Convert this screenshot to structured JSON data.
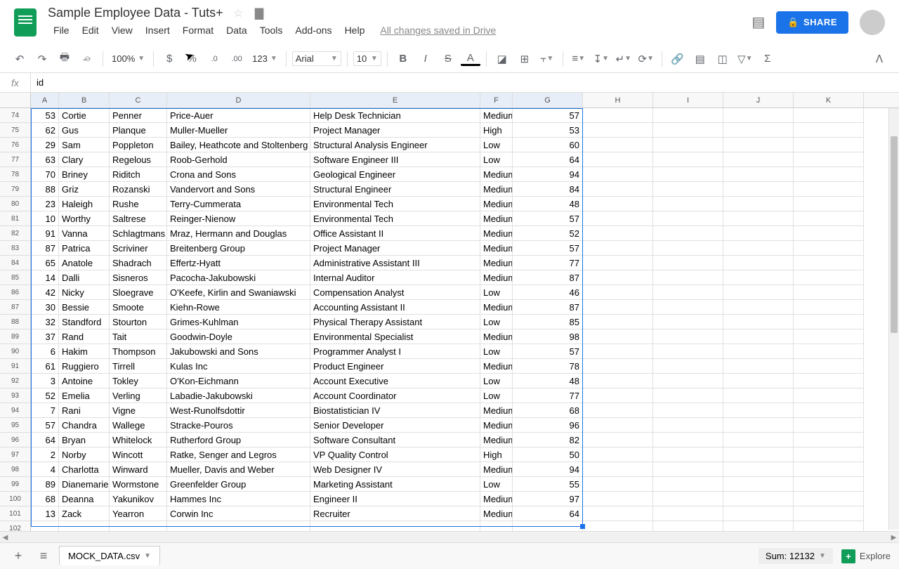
{
  "doc": {
    "title": "Sample Employee Data - Tuts+"
  },
  "menu": {
    "file": "File",
    "edit": "Edit",
    "view": "View",
    "insert": "Insert",
    "format": "Format",
    "data": "Data",
    "tools": "Tools",
    "addons": "Add-ons",
    "help": "Help",
    "saved": "All changes saved in Drive"
  },
  "share": {
    "label": "SHARE"
  },
  "toolbar": {
    "zoom": "100%",
    "format123": "123",
    "font": "Arial",
    "size": "10"
  },
  "formula": {
    "value": "id"
  },
  "columns": [
    "A",
    "B",
    "C",
    "D",
    "E",
    "F",
    "G",
    "H",
    "I",
    "J",
    "K"
  ],
  "rows": [
    {
      "n": 74,
      "a": "53",
      "b": "Cortie",
      "c": "Penner",
      "d": "Price-Auer",
      "e": "Help Desk Technician",
      "f": "Medium",
      "g": "57"
    },
    {
      "n": 75,
      "a": "62",
      "b": "Gus",
      "c": "Planque",
      "d": "Muller-Mueller",
      "e": "Project Manager",
      "f": "High",
      "g": "53"
    },
    {
      "n": 76,
      "a": "29",
      "b": "Sam",
      "c": "Poppleton",
      "d": "Bailey, Heathcote and Stoltenberg",
      "e": "Structural Analysis Engineer",
      "f": "Low",
      "g": "60"
    },
    {
      "n": 77,
      "a": "63",
      "b": "Clary",
      "c": "Regelous",
      "d": "Roob-Gerhold",
      "e": "Software Engineer III",
      "f": "Low",
      "g": "64"
    },
    {
      "n": 78,
      "a": "70",
      "b": "Briney",
      "c": "Riditch",
      "d": "Crona and Sons",
      "e": "Geological Engineer",
      "f": "Medium",
      "g": "94"
    },
    {
      "n": 79,
      "a": "88",
      "b": "Griz",
      "c": "Rozanski",
      "d": "Vandervort and Sons",
      "e": "Structural Engineer",
      "f": "Medium",
      "g": "84"
    },
    {
      "n": 80,
      "a": "23",
      "b": "Haleigh",
      "c": "Rushe",
      "d": "Terry-Cummerata",
      "e": "Environmental Tech",
      "f": "Medium",
      "g": "48"
    },
    {
      "n": 81,
      "a": "10",
      "b": "Worthy",
      "c": "Saltrese",
      "d": "Reinger-Nienow",
      "e": "Environmental Tech",
      "f": "Medium",
      "g": "57"
    },
    {
      "n": 82,
      "a": "91",
      "b": "Vanna",
      "c": "Schlagtmans",
      "d": "Mraz, Hermann and Douglas",
      "e": "Office Assistant II",
      "f": "Medium",
      "g": "52"
    },
    {
      "n": 83,
      "a": "87",
      "b": "Patrica",
      "c": "Scriviner",
      "d": "Breitenberg Group",
      "e": "Project Manager",
      "f": "Medium",
      "g": "57"
    },
    {
      "n": 84,
      "a": "65",
      "b": "Anatole",
      "c": "Shadrach",
      "d": "Effertz-Hyatt",
      "e": "Administrative Assistant III",
      "f": "Medium",
      "g": "77"
    },
    {
      "n": 85,
      "a": "14",
      "b": "Dalli",
      "c": "Sisneros",
      "d": "Pacocha-Jakubowski",
      "e": "Internal Auditor",
      "f": "Medium",
      "g": "87"
    },
    {
      "n": 86,
      "a": "42",
      "b": "Nicky",
      "c": "Sloegrave",
      "d": "O'Keefe, Kirlin and Swaniawski",
      "e": "Compensation Analyst",
      "f": "Low",
      "g": "46"
    },
    {
      "n": 87,
      "a": "30",
      "b": "Bessie",
      "c": "Smoote",
      "d": "Kiehn-Rowe",
      "e": "Accounting Assistant II",
      "f": "Medium",
      "g": "87"
    },
    {
      "n": 88,
      "a": "32",
      "b": "Standford",
      "c": "Stourton",
      "d": "Grimes-Kuhlman",
      "e": "Physical Therapy Assistant",
      "f": "Low",
      "g": "85"
    },
    {
      "n": 89,
      "a": "37",
      "b": "Rand",
      "c": "Tait",
      "d": "Goodwin-Doyle",
      "e": "Environmental Specialist",
      "f": "Medium",
      "g": "98"
    },
    {
      "n": 90,
      "a": "6",
      "b": "Hakim",
      "c": "Thompson",
      "d": "Jakubowski and Sons",
      "e": "Programmer Analyst I",
      "f": "Low",
      "g": "57"
    },
    {
      "n": 91,
      "a": "61",
      "b": "Ruggiero",
      "c": "Tirrell",
      "d": "Kulas Inc",
      "e": "Product Engineer",
      "f": "Medium",
      "g": "78"
    },
    {
      "n": 92,
      "a": "3",
      "b": "Antoine",
      "c": "Tokley",
      "d": "O'Kon-Eichmann",
      "e": "Account Executive",
      "f": "Low",
      "g": "48"
    },
    {
      "n": 93,
      "a": "52",
      "b": "Emelia",
      "c": "Verling",
      "d": "Labadie-Jakubowski",
      "e": "Account Coordinator",
      "f": "Low",
      "g": "77"
    },
    {
      "n": 94,
      "a": "7",
      "b": "Rani",
      "c": "Vigne",
      "d": "West-Runolfsdottir",
      "e": "Biostatistician IV",
      "f": "Medium",
      "g": "68"
    },
    {
      "n": 95,
      "a": "57",
      "b": "Chandra",
      "c": "Wallege",
      "d": "Stracke-Pouros",
      "e": "Senior Developer",
      "f": "Medium",
      "g": "96"
    },
    {
      "n": 96,
      "a": "64",
      "b": "Bryan",
      "c": "Whitelock",
      "d": "Rutherford Group",
      "e": "Software Consultant",
      "f": "Medium",
      "g": "82"
    },
    {
      "n": 97,
      "a": "2",
      "b": "Norby",
      "c": "Wincott",
      "d": "Ratke, Senger and Legros",
      "e": "VP Quality Control",
      "f": "High",
      "g": "50"
    },
    {
      "n": 98,
      "a": "4",
      "b": "Charlotta",
      "c": "Winward",
      "d": "Mueller, Davis and Weber",
      "e": "Web Designer IV",
      "f": "Medium",
      "g": "94"
    },
    {
      "n": 99,
      "a": "89",
      "b": "Dianemarie",
      "c": "Wormstone",
      "d": "Greenfelder Group",
      "e": "Marketing Assistant",
      "f": "Low",
      "g": "55"
    },
    {
      "n": 100,
      "a": "68",
      "b": "Deanna",
      "c": "Yakunikov",
      "d": "Hammes Inc",
      "e": "Engineer II",
      "f": "Medium",
      "g": "97"
    },
    {
      "n": 101,
      "a": "13",
      "b": "Zack",
      "c": "Yearron",
      "d": "Corwin Inc",
      "e": "Recruiter",
      "f": "Medium",
      "g": "64"
    },
    {
      "n": 102,
      "a": "",
      "b": "",
      "c": "",
      "d": "",
      "e": "",
      "f": "",
      "g": ""
    }
  ],
  "sheet": {
    "tab": "MOCK_DATA.csv",
    "sum": "Sum: 12132",
    "explore": "Explore"
  }
}
